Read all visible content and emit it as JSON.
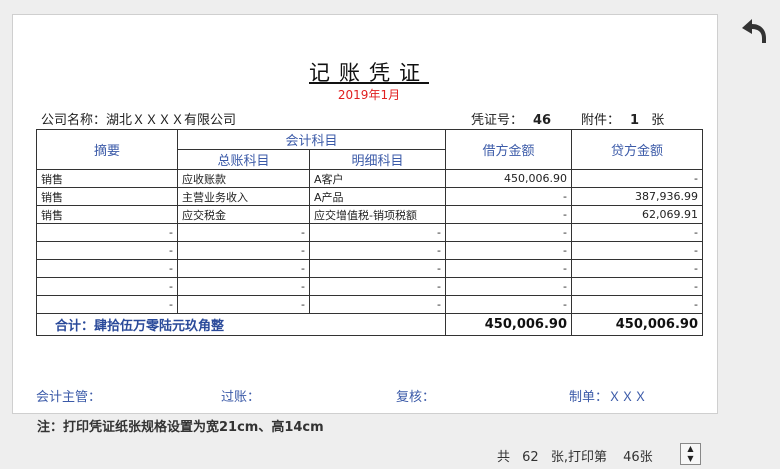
{
  "voucher": {
    "title": "记账凭证",
    "period": "2019年1月",
    "company": "公司名称：湖北ＸＸＸＸ有限公司",
    "voucher_no_label": "凭证号：",
    "voucher_no": "46",
    "attachment_label": "附件：",
    "attachment_count": "1",
    "attachment_unit": "张"
  },
  "table": {
    "header": {
      "summary": "摘要",
      "account_group": "会计科目",
      "general_account": "总账科目",
      "detail_account": "明细科目",
      "debit": "借方金额",
      "credit": "贷方金额"
    },
    "rows": [
      {
        "summary": "销售",
        "general": "应收账款",
        "detail": "A客户",
        "debit": "450,006.90",
        "credit": "-"
      },
      {
        "summary": "销售",
        "general": "主营业务收入",
        "detail": "A产品",
        "debit": "-",
        "credit": "387,936.99"
      },
      {
        "summary": "销售",
        "general": "应交税金",
        "detail": "应交增值税-销项税额",
        "debit": "-",
        "credit": "62,069.91"
      },
      {
        "summary": "-",
        "general": "-",
        "detail": "-",
        "debit": "-",
        "credit": "-"
      },
      {
        "summary": "-",
        "general": "-",
        "detail": "-",
        "debit": "-",
        "credit": "-"
      },
      {
        "summary": "-",
        "general": "-",
        "detail": "-",
        "debit": "-",
        "credit": "-"
      },
      {
        "summary": "-",
        "general": "-",
        "detail": "-",
        "debit": "-",
        "credit": "-"
      },
      {
        "summary": "-",
        "general": "-",
        "detail": "-",
        "debit": "-",
        "credit": "-"
      }
    ],
    "total_label": "合计：肆拾伍万零陆元玖角整",
    "total_debit": "450,006.90",
    "total_credit": "450,006.90"
  },
  "signatures": {
    "supervisor": "会计主管：",
    "posting": "过账：",
    "review": "复核：",
    "preparer": "制单：ＸＸＸ"
  },
  "note": "注：打印凭证纸张规格设置为宽21cm、高14cm",
  "pager": {
    "total_prefix": "共",
    "total_pages": "62",
    "mid_text": "张,打印第",
    "current_page": "46张"
  },
  "icons": {
    "back": "undo-arrow-icon",
    "spinner_up": "chevron-up-icon",
    "spinner_down": "chevron-down-icon"
  }
}
